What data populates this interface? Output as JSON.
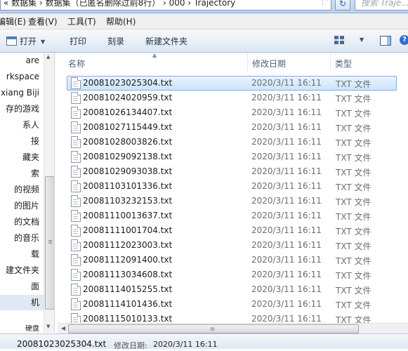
{
  "address_bar": {
    "path": "« 数据集 › 数据集（已匿名删除过前8行） › 000 › Trajectory",
    "search_placeholder": "搜索 Traje..."
  },
  "menu": {
    "items": [
      "编辑(E)",
      "查看(V)",
      "工具(T)",
      "帮助(H)"
    ]
  },
  "toolbar": {
    "open_label": "打开",
    "print_label": "打印",
    "burn_label": "刻录",
    "new_folder_label": "新建文件夹"
  },
  "navigation": {
    "items": [
      "are",
      "rkspace",
      "xiang Biji",
      "存的游戏",
      "系人",
      "接",
      "藏夹",
      "索",
      "的视频",
      "的图片",
      "的文档",
      "的音乐",
      "载",
      "建文件夹",
      "面",
      "机",
      "",
      "硬盘"
    ],
    "selected_index": 15
  },
  "columns": {
    "name": "名称",
    "date": "修改日期",
    "type": "类型"
  },
  "files": [
    {
      "name": "20081023025304.txt",
      "date": "2020/3/11 16:11",
      "type": "TXT 文件"
    },
    {
      "name": "20081024020959.txt",
      "date": "2020/3/11 16:11",
      "type": "TXT 文件"
    },
    {
      "name": "20081026134407.txt",
      "date": "2020/3/11 16:11",
      "type": "TXT 文件"
    },
    {
      "name": "20081027115449.txt",
      "date": "2020/3/11 16:11",
      "type": "TXT 文件"
    },
    {
      "name": "20081028003826.txt",
      "date": "2020/3/11 16:11",
      "type": "TXT 文件"
    },
    {
      "name": "20081029092138.txt",
      "date": "2020/3/11 16:11",
      "type": "TXT 文件"
    },
    {
      "name": "20081029093038.txt",
      "date": "2020/3/11 16:11",
      "type": "TXT 文件"
    },
    {
      "name": "20081103101336.txt",
      "date": "2020/3/11 16:11",
      "type": "TXT 文件"
    },
    {
      "name": "20081103232153.txt",
      "date": "2020/3/11 16:11",
      "type": "TXT 文件"
    },
    {
      "name": "20081110013637.txt",
      "date": "2020/3/11 16:11",
      "type": "TXT 文件"
    },
    {
      "name": "20081111001704.txt",
      "date": "2020/3/11 16:11",
      "type": "TXT 文件"
    },
    {
      "name": "20081112023003.txt",
      "date": "2020/3/11 16:11",
      "type": "TXT 文件"
    },
    {
      "name": "20081112091400.txt",
      "date": "2020/3/11 16:11",
      "type": "TXT 文件"
    },
    {
      "name": "20081113034608.txt",
      "date": "2020/3/11 16:11",
      "type": "TXT 文件"
    },
    {
      "name": "20081114015255.txt",
      "date": "2020/3/11 16:11",
      "type": "TXT 文件"
    },
    {
      "name": "20081114101436.txt",
      "date": "2020/3/11 16:11",
      "type": "TXT 文件"
    },
    {
      "name": "20081115010133.txt",
      "date": "2020/3/11 16:11",
      "type": "TXT 文件"
    }
  ],
  "selected_file_index": 0,
  "status": {
    "file_name": "20081023025304.txt",
    "date_label": "修改日期:",
    "date_value": "2020/3/11 16:11"
  },
  "icons": {
    "open": "text-file-icon",
    "view": "view-options-icon",
    "preview": "preview-pane-icon",
    "help": "help-icon",
    "refresh": "refresh-icon",
    "search": "search-icon",
    "file": "text-file-icon"
  },
  "colors": {
    "selection_fill": "#cce4fb",
    "selection_border": "#84acdd",
    "toolbar_bg": "#dbe6f2",
    "column_header_text": "#4c607a"
  }
}
